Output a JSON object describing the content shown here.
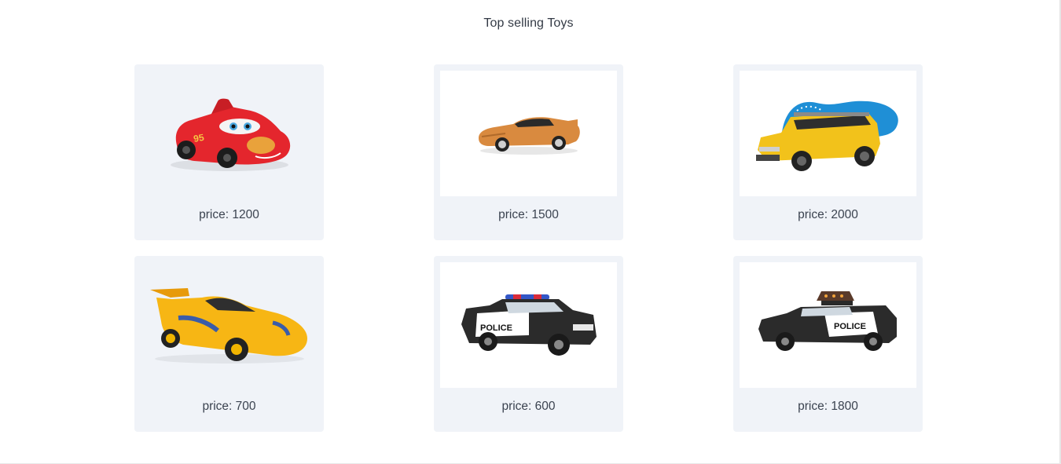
{
  "header": {
    "title": "Top selling Toys"
  },
  "products": [
    {
      "image_icon": "red-race-car-icon",
      "price_text": "price: 1200",
      "price": 1200,
      "color": "#e4262d"
    },
    {
      "image_icon": "orange-sports-car-icon",
      "price_text": "price: 1500",
      "price": 1500,
      "color": "#d98a3f"
    },
    {
      "image_icon": "yellow-suv-icon",
      "price_text": "price: 2000",
      "price": 2000,
      "color": "#f2c21b"
    },
    {
      "image_icon": "yellow-race-car-icon",
      "price_text": "price: 700",
      "price": 700,
      "color": "#f7b614"
    },
    {
      "image_icon": "police-car-icon",
      "price_text": "price: 600",
      "price": 600,
      "color": "#2b2b2b"
    },
    {
      "image_icon": "police-suv-icon",
      "price_text": "price: 1800",
      "price": 1800,
      "color": "#2b2b2b"
    }
  ],
  "colors": {
    "card_background": "#f0f3f8",
    "text": "#3b4350",
    "police_label": "POLICE"
  }
}
